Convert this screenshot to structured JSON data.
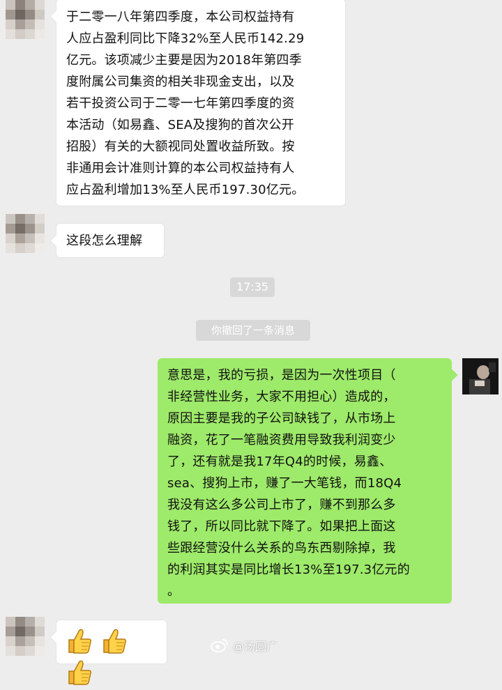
{
  "chat": {
    "messages": [
      {
        "sender": "other",
        "text": "于二零一八年第四季度，本公司权益持有\n人应占盈利同比下降32%至人民币142.29\n亿元。该项减少主要是因为2018年第四季\n度附属公司集资的相关非现金支出，以及\n若干投资公司于二零一七年第四季度的资\n本活动（如易鑫、SEA及搜狗的首次公开\n招股）有关的大额视同处置收益所致。按\n非通用会计准则计算的本公司权益持有人\n应占盈利增加13%至人民币197.30亿元。"
      },
      {
        "sender": "other",
        "text": "这段怎么理解"
      },
      {
        "sender": "system",
        "text": "17:35"
      },
      {
        "sender": "system",
        "text": "你撤回了一条消息"
      },
      {
        "sender": "me",
        "text": "意思是，我的亏损，是因为一次性项目（\n非经营性业务，大家不用担心）造成的，\n原因主要是我的子公司缺钱了，从市场上\n融资，花了一笔融资费用导致我利润变少\n了，还有就是我17年Q4的时候，易鑫、\nsea、搜狗上市，赚了一大笔钱，而18Q4\n我没有这么多公司上市了，赚不到那么多\n钱了，所以同比就下降了。如果把上面这\n些跟经营没什么关系的鸟东西剔除掉，我\n的利润其实是同比增长13%至197.3亿元的\n。"
      },
      {
        "sender": "other",
        "emoji": [
          "thumbs-up-icon",
          "thumbs-up-icon",
          "thumbs-up-icon"
        ]
      }
    ]
  },
  "watermark": {
    "text": "@汤圆广"
  },
  "colors": {
    "background": "#ededed",
    "my_bubble": "#9eea6a",
    "other_bubble": "#ffffff",
    "system_pill": "#d8d8d8"
  }
}
